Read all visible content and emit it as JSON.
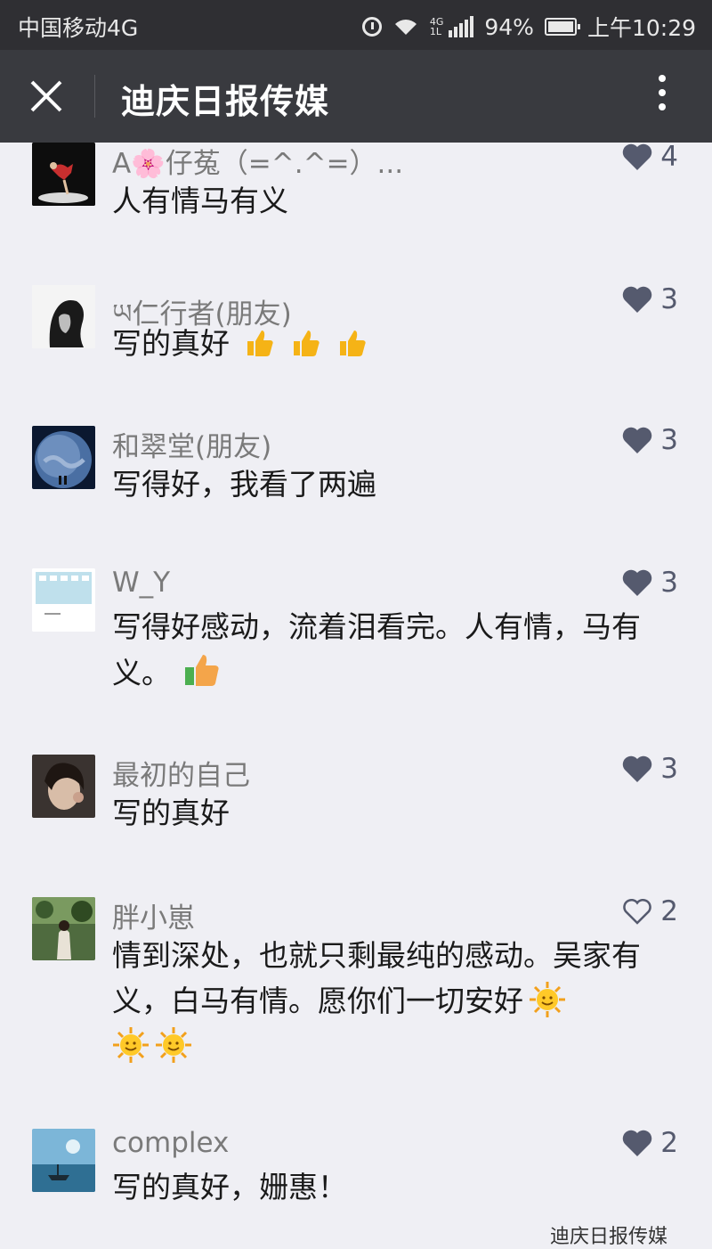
{
  "status_bar": {
    "carrier": "中国移动4G",
    "network_top": "4G",
    "network_bottom": "1L",
    "battery": "94%",
    "time": "上午10:29"
  },
  "header": {
    "title": "迪庆日报传媒"
  },
  "comments": [
    {
      "name": "A🌸仔菟（=^.^=）...",
      "text": "人有情马有义",
      "likes": "4",
      "liked": true
    },
    {
      "name": "ཡ仁行者(朋友)",
      "text": "写的真好",
      "likes": "3",
      "liked": true,
      "emojis": "thumbs-up x3"
    },
    {
      "name": "和翠堂(朋友)",
      "text": "写得好，我看了两遍",
      "likes": "3",
      "liked": true
    },
    {
      "name": "W_Y",
      "text": "写得好感动，流着泪看完。人有情，马有义。",
      "likes": "3",
      "liked": true,
      "emojis": "thumbs-up"
    },
    {
      "name": "最初的自己",
      "text": "写的真好",
      "likes": "3",
      "liked": true
    },
    {
      "name": "胖小崽",
      "text": "情到深处，也就只剩最纯的感动。吴家有义，白马有情。愿你们一切安好",
      "likes": "2",
      "liked": false,
      "emojis": "sun x3"
    },
    {
      "name": "complex",
      "text": "写的真好，姗惠！",
      "likes": "2",
      "liked": true
    }
  ],
  "watermark": "迪庆日报传媒",
  "colors": {
    "status_bar_bg": "#2f2f33",
    "header_bg": "#393a3f",
    "page_bg": "#efeff4",
    "like_color": "#555a6e"
  },
  "icons": [
    "close-icon",
    "more-icon",
    "heart-icon",
    "alarm-icon",
    "wifi-icon",
    "signal-icon",
    "battery-icon",
    "thumbs-up-icon",
    "sun-icon"
  ]
}
